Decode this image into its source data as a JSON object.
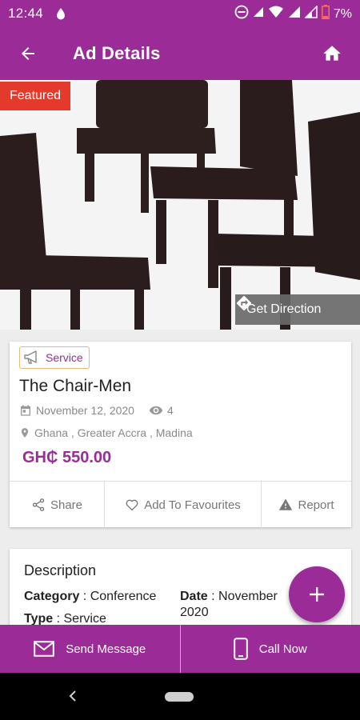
{
  "status_bar": {
    "time": "12:44",
    "battery": "7%",
    "icons": [
      "drop-icon",
      "dnd-icon",
      "signal-icon",
      "wifi-icon",
      "signal-icon",
      "signal-icon",
      "battery-low-icon"
    ]
  },
  "app_bar": {
    "title": "Ad Details",
    "back_icon": "arrow-left-icon",
    "home_icon": "home-icon"
  },
  "hero": {
    "badge": "Featured",
    "direction_label": "Get Direction",
    "direction_icon": "directions-icon"
  },
  "ad": {
    "category": "Service",
    "category_icon": "megaphone-icon",
    "title": "The Chair-Men",
    "date": "November 12, 2020",
    "views": "4",
    "location": "Ghana , Greater Accra , Madina",
    "price": "GH₵ 550.00"
  },
  "actions": [
    {
      "label": "Share",
      "icon": "share-icon"
    },
    {
      "label": "Add To Favourites",
      "icon": "heart-icon"
    },
    {
      "label": "Report",
      "icon": "warning-icon"
    }
  ],
  "description": {
    "title": "Description",
    "category_key": "Category",
    "category_value": "Conference",
    "type_key": "Type",
    "type_value": "Service",
    "date_key": "Date",
    "date_value_line1": "November",
    "date_value_line2": "2020"
  },
  "bottom_bar": {
    "message_label": "Send Message",
    "call_label": "Call Now"
  },
  "colors": {
    "primary": "#9b2c97",
    "featured": "#e43a2c",
    "chip_border": "#e5b978"
  }
}
